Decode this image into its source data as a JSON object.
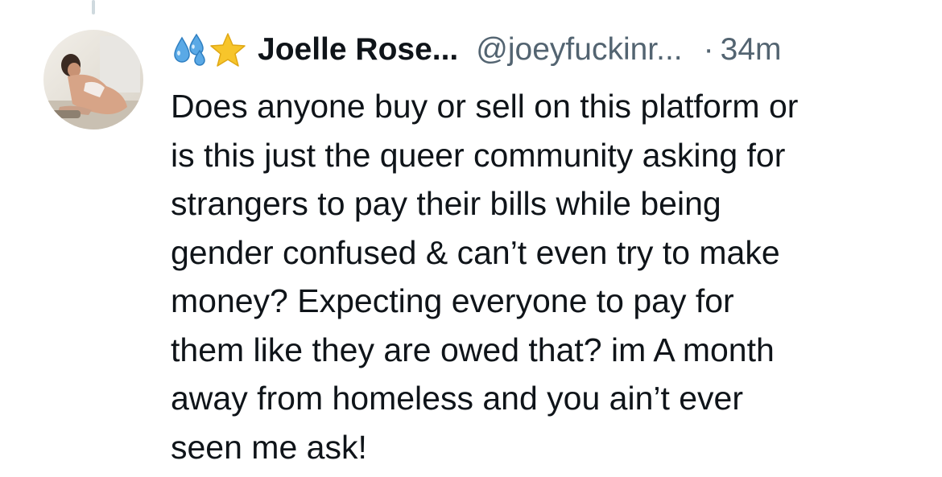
{
  "post": {
    "author": {
      "display_name": "Joelle Rose...",
      "handle": "@joeyfuckinr...",
      "name_emojis": [
        "sweat-droplets-icon",
        "star-icon"
      ]
    },
    "timestamp_separator": "·",
    "timestamp": "34m",
    "text": "Does anyone buy or sell on this platform or\nis this just the queer community asking for\nstrangers to pay their bills while being\ngender confused & can’t even try to make\nmoney? Expecting everyone to pay for\nthem like they are owed that? im A month\naway from homeless and you ain’t ever\nseen me ask!"
  },
  "colors": {
    "text_primary": "#0f1419",
    "text_secondary": "#536471",
    "thread_line": "#cfd9de",
    "droplet_blue": "#5aa9e6",
    "star_yellow": "#f7c52b"
  }
}
